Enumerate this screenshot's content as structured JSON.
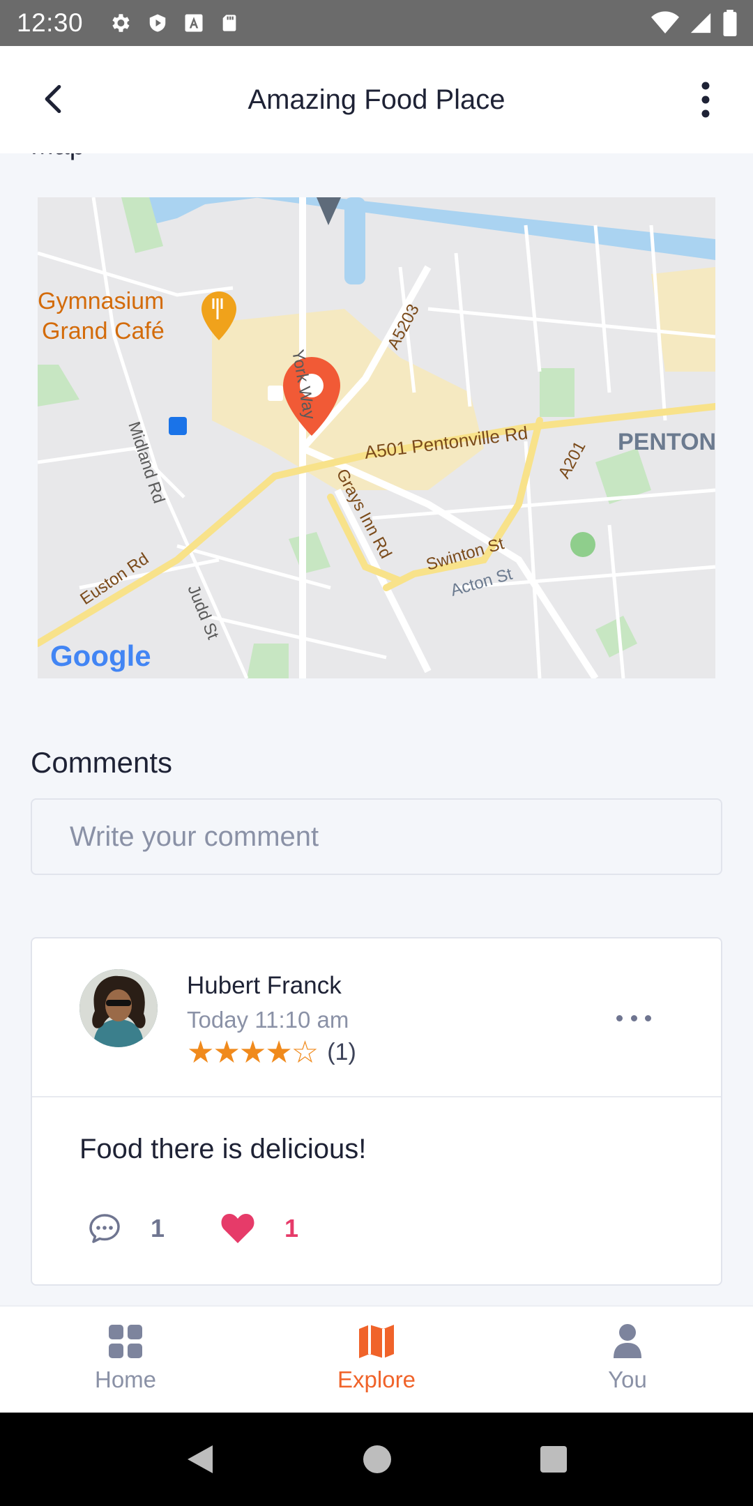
{
  "status_bar": {
    "time": "12:30"
  },
  "app_bar": {
    "title": "Amazing Food Place"
  },
  "map_section": {
    "label": "Map",
    "place_labels": {
      "cafe": "Gymnasium",
      "cafe2": "Grand Café",
      "york_way": "York Way",
      "a5203": "A5203",
      "pentonville": "A501  Pentonville Rd",
      "penton": "PENTON",
      "midland": "Midland Rd",
      "grays": "Grays Inn Rd",
      "a201": "A201",
      "swinton": "Swinton St",
      "acton": "Acton St",
      "euston": "Euston Rd",
      "judd": "Judd St",
      "google": "Google"
    }
  },
  "comments": {
    "heading": "Comments",
    "input_placeholder": "Write your comment",
    "items": [
      {
        "author": "Hubert Franck",
        "time": "Today 11:10 am",
        "stars": "★★★★☆",
        "rating_value": 4,
        "rating_count": "(1)",
        "text": "Food there is delicious!",
        "reply_count": "1",
        "like_count": "1"
      }
    ]
  },
  "bottom_nav": [
    {
      "label": "Home",
      "icon": "grid-icon"
    },
    {
      "label": "Explore",
      "icon": "map-icon",
      "active": true
    },
    {
      "label": "You",
      "icon": "person-icon"
    }
  ],
  "colors": {
    "accent": "#f0632a",
    "star": "#f08a1c",
    "like": "#e63b69",
    "muted": "#8a91a6"
  }
}
